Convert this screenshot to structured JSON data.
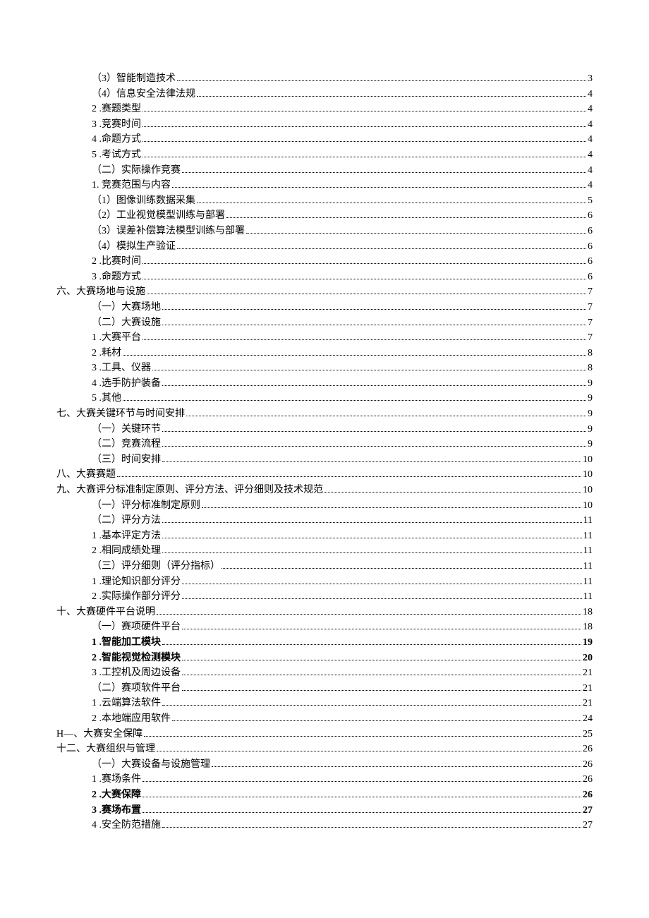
{
  "toc": [
    {
      "indent": 3,
      "label": "（3）智能制造技术",
      "page": "3",
      "bold": false
    },
    {
      "indent": 3,
      "label": "（4）信息安全法律法规",
      "page": "4",
      "bold": false
    },
    {
      "indent": 2,
      "label": "2 .赛题类型",
      "page": "4",
      "bold": false
    },
    {
      "indent": 2,
      "label": "3 .竞赛时间",
      "page": "4",
      "bold": false
    },
    {
      "indent": 2,
      "label": "4 .命题方式",
      "page": "4",
      "bold": false
    },
    {
      "indent": 2,
      "label": "5 .考试方式",
      "page": "4",
      "bold": false
    },
    {
      "indent": 2,
      "label": "（二）实际操作竞赛 ",
      "page": "4",
      "bold": false
    },
    {
      "indent": 2,
      "label": "1. 竞赛范围与内容",
      "page": "4",
      "bold": false
    },
    {
      "indent": 3,
      "label": "（1）图像训练数据采集 ",
      "page": "5",
      "bold": false
    },
    {
      "indent": 3,
      "label": "（2）工业视觉模型训练与部署 ",
      "page": "6",
      "bold": false
    },
    {
      "indent": 3,
      "label": "（3）误差补偿算法模型训练与部署",
      "page": "6",
      "bold": false
    },
    {
      "indent": 3,
      "label": "（4）模拟生产验证 ",
      "page": "6",
      "bold": false
    },
    {
      "indent": 2,
      "label": "2 .比赛时间",
      "page": "6",
      "bold": false
    },
    {
      "indent": 2,
      "label": "3 .命题方式",
      "page": "6",
      "bold": false
    },
    {
      "indent": 0,
      "label": "六、大赛场地与设施 ",
      "page": "7",
      "bold": false
    },
    {
      "indent": 3,
      "label": "（一）大赛场地 ",
      "page": "7",
      "bold": false
    },
    {
      "indent": 3,
      "label": "（二）大赛设施 ",
      "page": "7",
      "bold": false
    },
    {
      "indent": 2,
      "label": "1 .大赛平台 ",
      "page": "7",
      "bold": false
    },
    {
      "indent": 2,
      "label": "2 .耗材",
      "page": "8",
      "bold": false
    },
    {
      "indent": 2,
      "label": "3 .工具、仪器 ",
      "page": "8",
      "bold": false
    },
    {
      "indent": 2,
      "label": "4 .选手防护装备",
      "page": "9",
      "bold": false
    },
    {
      "indent": 2,
      "label": "5 .其他",
      "page": "9",
      "bold": false
    },
    {
      "indent": 0,
      "label": "七、大赛关键环节与时间安排 ",
      "page": "9",
      "bold": false
    },
    {
      "indent": 3,
      "label": "（一）关键环节 ",
      "page": "9",
      "bold": false
    },
    {
      "indent": 3,
      "label": "（二）竞赛流程 ",
      "page": "9",
      "bold": false
    },
    {
      "indent": 3,
      "label": "（三）时间安排 ",
      "page": "10",
      "bold": false
    },
    {
      "indent": 0,
      "label": "八、大赛赛题 ",
      "page": "10",
      "bold": false
    },
    {
      "indent": 0,
      "label": "九、大赛评分标准制定原则、评分方法、评分细则及技术规范 ",
      "page": "10",
      "bold": false
    },
    {
      "indent": 3,
      "label": "（一）评分标准制定原则 ",
      "page": "10",
      "bold": false
    },
    {
      "indent": 3,
      "label": "（二）评分方法 ",
      "page": "11",
      "bold": false
    },
    {
      "indent": 2,
      "label": "1 .基本评定方法",
      "page": "11",
      "bold": false
    },
    {
      "indent": 2,
      "label": "2 .相同成绩处理",
      "page": "11",
      "bold": false
    },
    {
      "indent": 3,
      "label": "（三）评分细则（评分指标） ",
      "page": "11",
      "bold": false
    },
    {
      "indent": 2,
      "label": "1 .理论知识部分评分",
      "page": "11",
      "bold": false
    },
    {
      "indent": 2,
      "label": "2 .实际操作部分评分",
      "page": "11",
      "bold": false
    },
    {
      "indent": 0,
      "label": "十、大赛硬件平台说明 ",
      "page": "18",
      "bold": false
    },
    {
      "indent": 3,
      "label": "（一）赛项硬件平台 ",
      "page": "18",
      "bold": false
    },
    {
      "indent": 2,
      "label": "1 .智能加工模块 ",
      "page": "19",
      "bold": true
    },
    {
      "indent": 2,
      "label": "2 .智能视觉检测模块 ",
      "page": "20",
      "bold": true
    },
    {
      "indent": 2,
      "label": "3 .工控机及周边设备",
      "page": "21",
      "bold": false
    },
    {
      "indent": 3,
      "label": "（二）赛项软件平台 ",
      "page": "21",
      "bold": false
    },
    {
      "indent": 2,
      "label": "1 .云端算法软件",
      "page": "21",
      "bold": false
    },
    {
      "indent": 2,
      "label": "2 .本地端应用软件",
      "page": "24",
      "bold": false
    },
    {
      "indent": 0,
      "label": "H—、大赛安全保障",
      "page": "25",
      "bold": false
    },
    {
      "indent": 0,
      "label": "十二、大赛组织与管理 ",
      "page": "26",
      "bold": false
    },
    {
      "indent": 3,
      "label": "（一）大赛设备与设施管理 ",
      "page": "26",
      "bold": false
    },
    {
      "indent": 2,
      "label": "1 .赛场条件",
      "page": "26",
      "bold": false
    },
    {
      "indent": 2,
      "label": "2 .大赛保障 ",
      "page": "26",
      "bold": true
    },
    {
      "indent": 2,
      "label": "3 .赛场布置 ",
      "page": "27",
      "bold": true
    },
    {
      "indent": 2,
      "label": "4 .安全防范措施",
      "page": "27",
      "bold": false
    }
  ]
}
